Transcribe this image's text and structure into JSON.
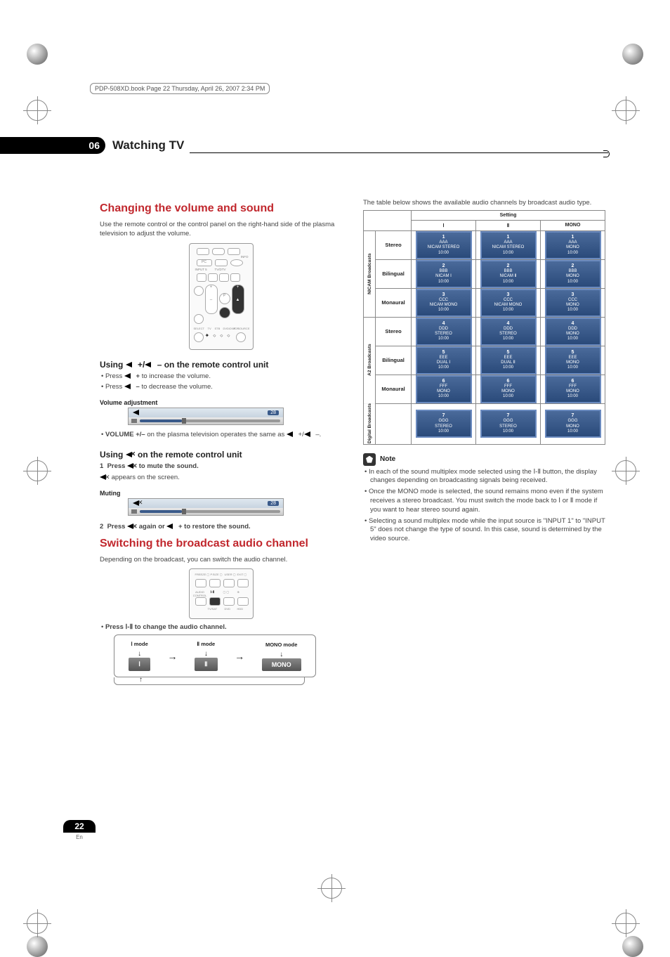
{
  "meta": {
    "header_note": "PDP-508XD.book  Page 22  Thursday, April 26, 2007  2:34 PM"
  },
  "chapter": {
    "number": "06",
    "title": "Watching TV"
  },
  "left": {
    "h_volume": "Changing the volume and sound",
    "p_volume_intro": "Use the remote control or the control panel on the right-hand side of the plasma television to adjust the volume.",
    "h_using_vol": "Using          +/          – on the remote control unit",
    "b_vol_inc": "Press          + to increase the volume.",
    "b_vol_dec": "Press          – to decrease the volume.",
    "label_voladj": "Volume adjustment",
    "osd_value": "28",
    "b_volume_pm": "VOLUME +/– on the plasma television operates the same as           +/          –.",
    "h_using_mute": "Using        on the remote control unit",
    "step1_num": "1",
    "step1": "Press        to mute the sound.",
    "step1_sub": "       appears on the screen.",
    "label_muting": "Muting",
    "step2_num": "2",
    "step2": "Press        again or          + to restore the sound.",
    "h_switch": "Switching the broadcast audio channel",
    "p_switch": "Depending on the broadcast, you can switch the audio channel.",
    "b_press_change": "Press       to change the audio channel.",
    "mode1_label": "Ⅰ mode",
    "mode1_box": "Ⅰ",
    "mode2_label": "Ⅱ mode",
    "mode2_box": "Ⅱ",
    "mode3_label": "MONO mode",
    "mode3_box": "MONO"
  },
  "right": {
    "p_table_intro": "The table below shows the available audio channels by broadcast audio type.",
    "th_setting": "Setting",
    "th_c1": "Ⅰ",
    "th_c2": "Ⅱ",
    "th_c3": "MONO",
    "g1": "NICAM Broadcasts",
    "g2": "A2 Broadcasts",
    "g3": "Digital Broadcasts",
    "r_stereo": "Stereo",
    "r_bilingual": "Bilingual",
    "r_monaural": "Monaural",
    "cells": {
      "g1_stereo": {
        "c1": {
          "n": "1",
          "a": "AAA",
          "b": "NICAM STEREO",
          "t": "10:00"
        },
        "c2": {
          "n": "1",
          "a": "AAA",
          "b": "NICAM STEREO",
          "t": "10:00"
        },
        "c3": {
          "n": "1",
          "a": "AAA",
          "b": "MONO",
          "t": "10:00"
        }
      },
      "g1_biling": {
        "c1": {
          "n": "2",
          "a": "BBB",
          "b": "NICAM Ⅰ",
          "t": "10:00"
        },
        "c2": {
          "n": "2",
          "a": "BBB",
          "b": "NICAM Ⅱ",
          "t": "10:00"
        },
        "c3": {
          "n": "2",
          "a": "BBB",
          "b": "MONO",
          "t": "10:00"
        }
      },
      "g1_mono": {
        "c1": {
          "n": "3",
          "a": "CCC",
          "b": "NICAM MONO",
          "t": "10:00"
        },
        "c2": {
          "n": "3",
          "a": "CCC",
          "b": "NICAM MONO",
          "t": "10:00"
        },
        "c3": {
          "n": "3",
          "a": "CCC",
          "b": "MONO",
          "t": "10:00"
        }
      },
      "g2_stereo": {
        "c1": {
          "n": "4",
          "a": "DDD",
          "b": "STEREO",
          "t": "10:00"
        },
        "c2": {
          "n": "4",
          "a": "DDD",
          "b": "STEREO",
          "t": "10:00"
        },
        "c3": {
          "n": "4",
          "a": "DDD",
          "b": "MONO",
          "t": "10:00"
        }
      },
      "g2_biling": {
        "c1": {
          "n": "5",
          "a": "EEE",
          "b": "DUAL Ⅰ",
          "t": "10:00"
        },
        "c2": {
          "n": "5",
          "a": "EEE",
          "b": "DUAL Ⅱ",
          "t": "10:00"
        },
        "c3": {
          "n": "5",
          "a": "EEE",
          "b": "MONO",
          "t": "10:00"
        }
      },
      "g2_mono": {
        "c1": {
          "n": "6",
          "a": "FFF",
          "b": "MONO",
          "t": "10:00"
        },
        "c2": {
          "n": "6",
          "a": "FFF",
          "b": "MONO",
          "t": "10:00"
        },
        "c3": {
          "n": "6",
          "a": "FFF",
          "b": "MONO",
          "t": "10:00"
        }
      },
      "g3_any": {
        "c1": {
          "n": "7",
          "a": "GGG",
          "b": "STEREO",
          "t": "10:00"
        },
        "c2": {
          "n": "7",
          "a": "GGG",
          "b": "STEREO",
          "t": "10:00"
        },
        "c3": {
          "n": "7",
          "a": "GGG",
          "b": "MONO",
          "t": "10:00"
        }
      }
    },
    "note_label": "Note",
    "note1": "In each of the sound multiplex mode selected using the Ⅰ-Ⅱ button, the display changes depending on broadcasting signals being received.",
    "note2": "Once the MONO mode is selected, the sound remains mono even if the system receives a stereo broadcast. You must switch the mode back to Ⅰ or Ⅱ mode if you want to hear stereo sound again.",
    "note3": "Selecting a sound multiplex mode while the input source is \"INPUT 1\" to \"INPUT 5\" does not change the type of sound. In this case, sound is determined by the video source."
  },
  "footer": {
    "page": "22",
    "lang": "En"
  },
  "remote_labels": {
    "info": "INFO",
    "pc": "PC",
    "tvdtv": "TV/DTV",
    "inputs": "INPUT 5",
    "p": "P",
    "select": "SELECT",
    "tv": "TV",
    "stb": "STB",
    "dvr": "DVD/DVR",
    "vcr": "VCR",
    "source": "SOURCE",
    "audio": "AUDIO CONTROL",
    "one_two": "Ⅰ-Ⅱ",
    "sat": "TV/SAT",
    "dvd": "DVD",
    "hdd": "HDD"
  }
}
